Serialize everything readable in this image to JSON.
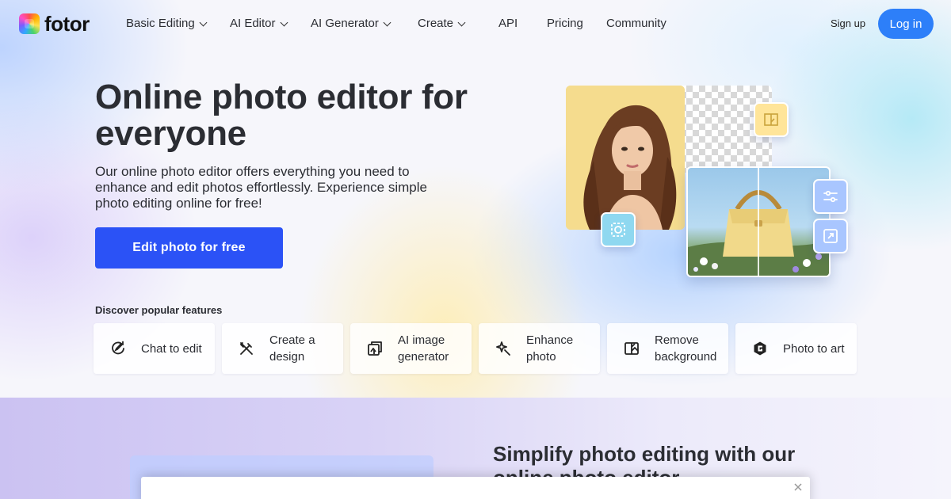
{
  "nav": {
    "logo_text": "fotor",
    "items": [
      {
        "label": "Basic Editing",
        "has_dropdown": true
      },
      {
        "label": "AI Editor",
        "has_dropdown": true
      },
      {
        "label": "AI Generator",
        "has_dropdown": true
      },
      {
        "label": "Create",
        "has_dropdown": true
      },
      {
        "label": "API",
        "has_dropdown": false
      },
      {
        "label": "Pricing",
        "has_dropdown": false
      },
      {
        "label": "Community",
        "has_dropdown": false
      }
    ],
    "signup_label": "Sign up",
    "login_label": "Log in"
  },
  "hero": {
    "title": "Online photo editor for everyone",
    "description": "Our online photo editor offers everything you need to enhance and edit photos effortlessly. Experience simple photo editing online for free!",
    "cta_label": "Edit photo for free",
    "discover_label": "Discover popular features",
    "features": [
      {
        "label": "Chat to edit",
        "icon": "chat-edit-icon"
      },
      {
        "label": "Create a design",
        "icon": "design-tools-icon"
      },
      {
        "label": "AI image generator",
        "icon": "ai-image-icon"
      },
      {
        "label": "Enhance photo",
        "icon": "enhance-icon"
      },
      {
        "label": "Remove background",
        "icon": "remove-bg-icon"
      },
      {
        "label": "Photo to art",
        "icon": "photo-art-icon"
      }
    ]
  },
  "section2": {
    "title": "Simplify photo editing with our online photo editor"
  },
  "colors": {
    "cta": "#2b52f6",
    "login": "#2d7ff9",
    "text": "#2b2d33"
  }
}
